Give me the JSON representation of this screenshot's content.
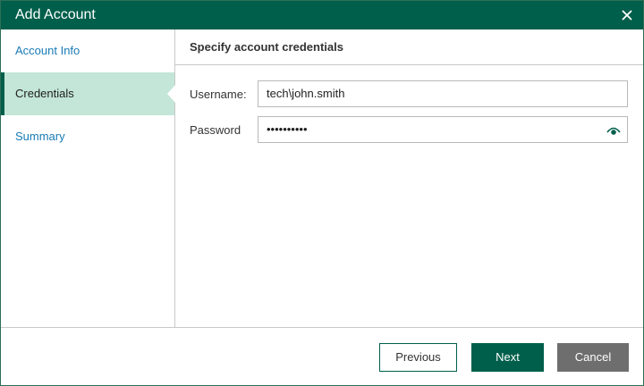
{
  "window": {
    "title": "Add Account",
    "close_icon": "close-icon"
  },
  "sidebar": {
    "items": [
      {
        "label": "Account Info",
        "active": false
      },
      {
        "label": "Credentials",
        "active": true
      },
      {
        "label": "Summary",
        "active": false
      }
    ]
  },
  "main": {
    "header": "Specify account credentials",
    "username": {
      "label": "Username:",
      "value": "tech\\john.smith"
    },
    "password": {
      "label": "Password",
      "value": "••••••••••",
      "reveal_icon": "eye-icon"
    }
  },
  "footer": {
    "previous_label": "Previous",
    "next_label": "Next",
    "cancel_label": "Cancel"
  },
  "colors": {
    "titlebar": "#005f4b",
    "active_step_bg": "#c3e6d8",
    "link": "#1a7bb5",
    "cancel_bg": "#6e6e6e"
  }
}
